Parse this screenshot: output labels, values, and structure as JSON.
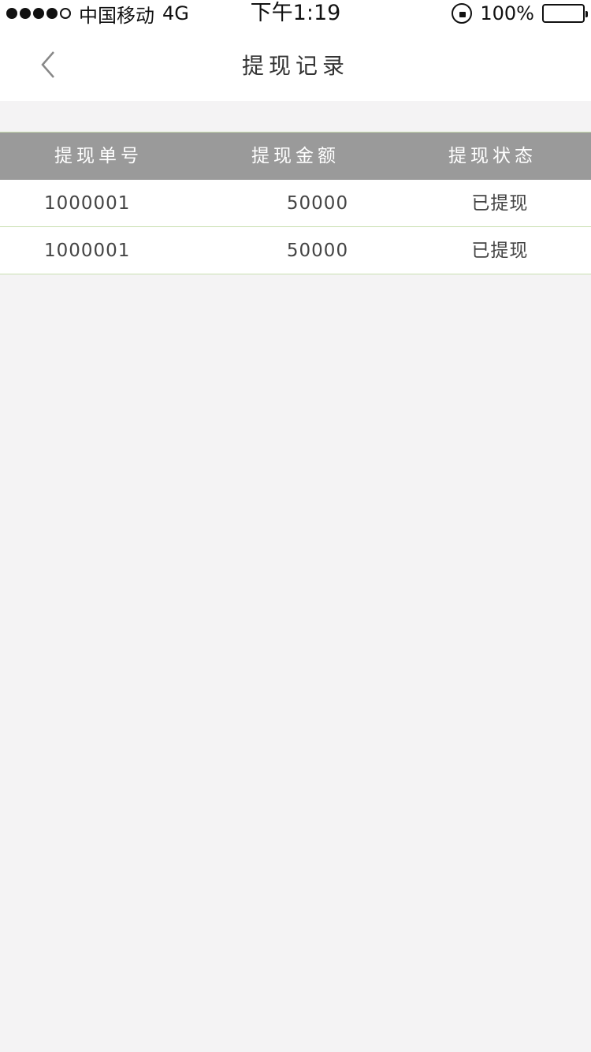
{
  "status_bar": {
    "carrier": "中国移动",
    "network": "4G",
    "time": "下午1:19",
    "battery": "100%",
    "signal_bars_filled": 4,
    "signal_bars_total": 5
  },
  "nav": {
    "title": "提现记录",
    "back_icon": "chevron-left-icon"
  },
  "table": {
    "headers": [
      "提现单号",
      "提现金额",
      "提现状态"
    ],
    "rows": [
      {
        "id": "1000001",
        "amount": "50000",
        "status": "已提现"
      },
      {
        "id": "1000001",
        "amount": "50000",
        "status": "已提现"
      }
    ]
  },
  "colors": {
    "header_bg": "#9a9a9a",
    "row_divider": "#c9dfb0",
    "page_bg": "#f4f3f4"
  }
}
